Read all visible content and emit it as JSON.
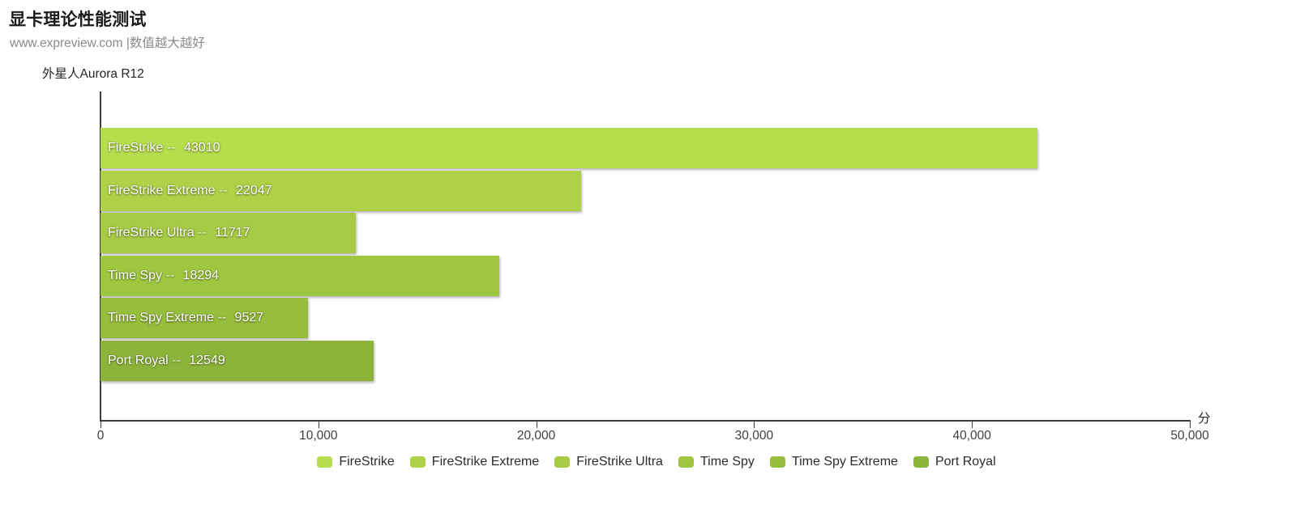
{
  "header": {
    "title": "显卡理论性能测试",
    "subtitle": "www.expreview.com |数值越大越好",
    "series_name": "外星人Aurora R12"
  },
  "chart_data": {
    "type": "bar",
    "orientation": "horizontal",
    "title": "显卡理论性能测试",
    "subtitle": "www.expreview.com |数值越大越好",
    "group_label": "外星人Aurora R12",
    "xlabel": "分",
    "ylabel": "",
    "xlim": [
      0,
      50000
    ],
    "grid": false,
    "legend_position": "bottom",
    "value_separator": "--",
    "categories": [
      "FireStrike",
      "FireStrike Extreme",
      "FireStrike Ultra",
      "Time Spy",
      "Time Spy Extreme",
      "Port Royal"
    ],
    "values": [
      43010,
      22047,
      11717,
      18294,
      9527,
      12549
    ],
    "value_labels": [
      "43010",
      "22047",
      "11717",
      "18294",
      "9527",
      "12549"
    ],
    "colors": [
      "#b5dd4c",
      "#aed148",
      "#a7cb45",
      "#9fc63f",
      "#97bd3c",
      "#8cb43a"
    ],
    "bars": [
      {
        "label": "FireStrike",
        "value": 43010,
        "value_label": "43010",
        "color": "#b5dd4c"
      },
      {
        "label": "FireStrike Extreme",
        "value": 22047,
        "value_label": "22047",
        "color": "#aed148"
      },
      {
        "label": "FireStrike Ultra",
        "value": 11717,
        "value_label": "11717",
        "color": "#a7cb45"
      },
      {
        "label": "Time Spy",
        "value": 18294,
        "value_label": "18294",
        "color": "#9fc63f"
      },
      {
        "label": "Time Spy Extreme",
        "value": 9527,
        "value_label": "9527",
        "color": "#97bd3c"
      },
      {
        "label": "Port Royal",
        "value": 12549,
        "value_label": "12549",
        "color": "#8cb43a"
      }
    ],
    "xticks": [
      0,
      10000,
      20000,
      30000,
      40000,
      50000
    ],
    "xtick_labels": [
      "0",
      "10,000",
      "20,000",
      "30,000",
      "40,000",
      "50,000"
    ],
    "legend": [
      {
        "label": "FireStrike",
        "color": "#b5dd4c"
      },
      {
        "label": "FireStrike Extreme",
        "color": "#aed148"
      },
      {
        "label": "FireStrike Ultra",
        "color": "#a7cb45"
      },
      {
        "label": "Time Spy",
        "color": "#9fc63f"
      },
      {
        "label": "Time Spy Extreme",
        "color": "#97bd3c"
      },
      {
        "label": "Port Royal",
        "color": "#8cb43a"
      }
    ]
  }
}
